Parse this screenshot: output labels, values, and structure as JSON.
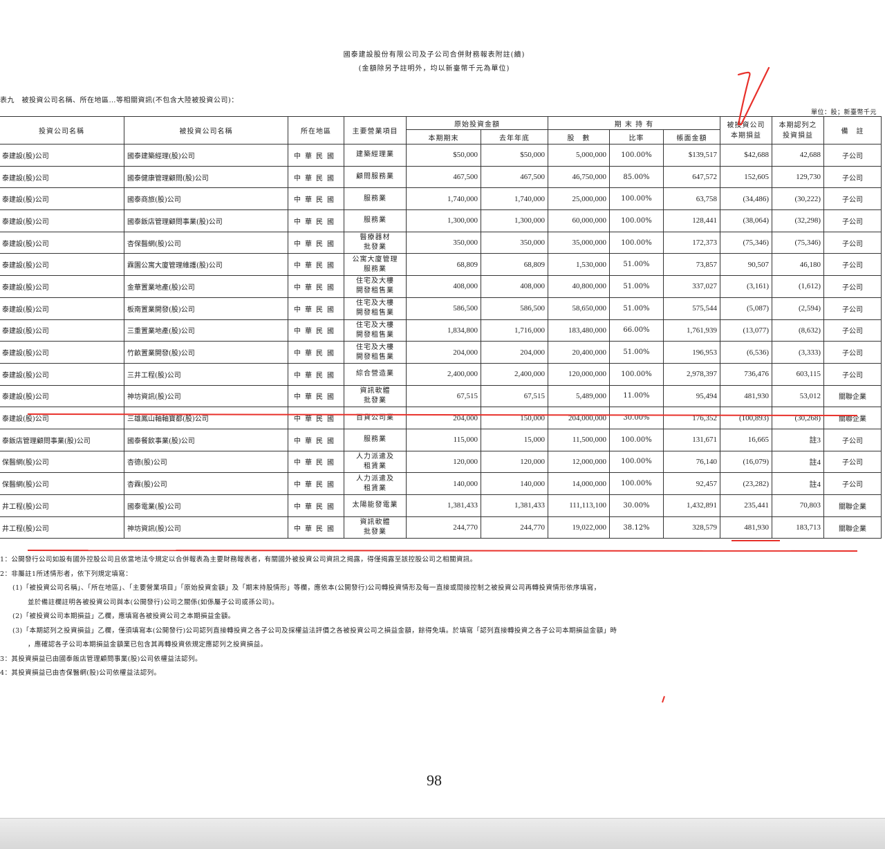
{
  "header": {
    "title": "國泰建設股份有限公司及子公司合併財務報表附註(續)",
    "subtitle": "(金額除另予註明外，均以新臺幣千元為單位)"
  },
  "caption": "表九　被投資公司名稱、所在地區…等相關資訊(不包含大陸被投資公司)：",
  "unit_note": "單位：股；新臺幣千元",
  "table": {
    "headers": {
      "investor": "投資公司名稱",
      "investee": "被投資公司名稱",
      "region": "所在地區",
      "business": "主要營業項目",
      "original": "原始投資金額",
      "orig_current": "本期期末",
      "orig_prior": "去年年底",
      "holding": "期 末 持 有",
      "shares": "股　數",
      "ratio": "比率",
      "book": "帳面金額",
      "pl_line1": "被投資公司",
      "pl_line2": "本期損益",
      "recog_line1": "本期認列之",
      "recog_line2": "投資損益",
      "remark": "備　註"
    },
    "rows": [
      {
        "investor": "泰建設(股)公司",
        "investee": "國泰建築經理(股)公司",
        "region": "中華民國",
        "business": "建築經理業",
        "orig_current": "$50,000",
        "orig_prior": "$50,000",
        "shares": "5,000,000",
        "ratio": "100.00%",
        "book": "$139,517",
        "pl": "$42,688",
        "recog": "42,688",
        "remark": "子公司"
      },
      {
        "investor": "泰建設(股)公司",
        "investee": "國泰健康管理顧問(股)公司",
        "region": "中華民國",
        "business": "顧問服務業",
        "orig_current": "467,500",
        "orig_prior": "467,500",
        "shares": "46,750,000",
        "ratio": "85.00%",
        "book": "647,572",
        "pl": "152,605",
        "recog": "129,730",
        "remark": "子公司"
      },
      {
        "investor": "泰建設(股)公司",
        "investee": "國泰商旅(股)公司",
        "region": "中華民國",
        "business": "服務業",
        "orig_current": "1,740,000",
        "orig_prior": "1,740,000",
        "shares": "25,000,000",
        "ratio": "100.00%",
        "book": "63,758",
        "pl": "(34,486)",
        "recog": "(30,222)",
        "remark": "子公司"
      },
      {
        "investor": "泰建設(股)公司",
        "investee": "國泰飯店管理顧問事業(股)公司",
        "region": "中華民國",
        "business": "服務業",
        "orig_current": "1,300,000",
        "orig_prior": "1,300,000",
        "shares": "60,000,000",
        "ratio": "100.00%",
        "book": "128,441",
        "pl": "(38,064)",
        "recog": "(32,298)",
        "remark": "子公司"
      },
      {
        "investor": "泰建設(股)公司",
        "investee": "杏保醫網(股)公司",
        "region": "中華民國",
        "business": "醫療器材 批發業",
        "orig_current": "350,000",
        "orig_prior": "350,000",
        "shares": "35,000,000",
        "ratio": "100.00%",
        "book": "172,373",
        "pl": "(75,346)",
        "recog": "(75,346)",
        "remark": "子公司"
      },
      {
        "investor": "泰建設(股)公司",
        "investee": "霖園公寓大廈管理維護(股)公司",
        "region": "中華民國",
        "business": "公寓大廈管理 服務業",
        "orig_current": "68,809",
        "orig_prior": "68,809",
        "shares": "1,530,000",
        "ratio": "51.00%",
        "book": "73,857",
        "pl": "90,507",
        "recog": "46,180",
        "remark": "子公司"
      },
      {
        "investor": "泰建設(股)公司",
        "investee": "金華置業地產(股)公司",
        "region": "中華民國",
        "business": "住宅及大樓 開發租售業",
        "orig_current": "408,000",
        "orig_prior": "408,000",
        "shares": "40,800,000",
        "ratio": "51.00%",
        "book": "337,027",
        "pl": "(3,161)",
        "recog": "(1,612)",
        "remark": "子公司"
      },
      {
        "investor": "泰建設(股)公司",
        "investee": "板南置業開發(股)公司",
        "region": "中華民國",
        "business": "住宅及大樓 開發租售業",
        "orig_current": "586,500",
        "orig_prior": "586,500",
        "shares": "58,650,000",
        "ratio": "51.00%",
        "book": "575,544",
        "pl": "(5,087)",
        "recog": "(2,594)",
        "remark": "子公司"
      },
      {
        "investor": "泰建設(股)公司",
        "investee": "三重置業地產(股)公司",
        "region": "中華民國",
        "business": "住宅及大樓 開發租售業",
        "orig_current": "1,834,800",
        "orig_prior": "1,716,000",
        "shares": "183,480,000",
        "ratio": "66.00%",
        "book": "1,761,939",
        "pl": "(13,077)",
        "recog": "(8,632)",
        "remark": "子公司"
      },
      {
        "investor": "泰建設(股)公司",
        "investee": "竹畝置業開發(股)公司",
        "region": "中華民國",
        "business": "住宅及大樓 開發租售業",
        "orig_current": "204,000",
        "orig_prior": "204,000",
        "shares": "20,400,000",
        "ratio": "51.00%",
        "book": "196,953",
        "pl": "(6,536)",
        "recog": "(3,333)",
        "remark": "子公司"
      },
      {
        "investor": "泰建設(股)公司",
        "investee": "三井工程(股)公司",
        "region": "中華民國",
        "business": "綜合營造業",
        "orig_current": "2,400,000",
        "orig_prior": "2,400,000",
        "shares": "120,000,000",
        "ratio": "100.00%",
        "book": "2,978,397",
        "pl": "736,476",
        "recog": "603,115",
        "remark": "子公司"
      },
      {
        "investor": "泰建設(股)公司",
        "investee": "神坊資訊(股)公司",
        "region": "中華民國",
        "business": "資訊軟體 批發業",
        "orig_current": "67,515",
        "orig_prior": "67,515",
        "shares": "5,489,000",
        "ratio": "11.00%",
        "book": "95,494",
        "pl": "481,930",
        "recog": "53,012",
        "remark": "關聯企業"
      },
      {
        "investor": "泰建設(股)公司",
        "investee": "三雄鳳山軸軸寶都(股)公司",
        "region": "中華民國",
        "business": "百貨公司業",
        "orig_current": "204,000",
        "orig_prior": "150,000",
        "shares": "204,000,000",
        "ratio": "30.00%",
        "book": "176,352",
        "pl": "(100,893)",
        "recog": "(30,268)",
        "remark": "關聯企業"
      },
      {
        "investor": "泰飯店管理顧問事業(股)公司",
        "investee": "國泰餐飲事業(股)公司",
        "region": "中華民國",
        "business": "服務業",
        "orig_current": "115,000",
        "orig_prior": "15,000",
        "shares": "11,500,000",
        "ratio": "100.00%",
        "book": "131,671",
        "pl": "16,665",
        "recog": "註3",
        "remark": "子公司"
      },
      {
        "investor": "保醫網(股)公司",
        "investee": "杏德(股)公司",
        "region": "中華民國",
        "business": "人力派遣及 租賃業",
        "orig_current": "120,000",
        "orig_prior": "120,000",
        "shares": "12,000,000",
        "ratio": "100.00%",
        "book": "76,140",
        "pl": "(16,079)",
        "recog": "註4",
        "remark": "子公司"
      },
      {
        "investor": "保醫網(股)公司",
        "investee": "杏霖(股)公司",
        "region": "中華民國",
        "business": "人力派遣及 租賃業",
        "orig_current": "140,000",
        "orig_prior": "140,000",
        "shares": "14,000,000",
        "ratio": "100.00%",
        "book": "92,457",
        "pl": "(23,282)",
        "recog": "註4",
        "remark": "子公司"
      },
      {
        "investor": "井工程(股)公司",
        "investee": "國泰電業(股)公司",
        "region": "中華民國",
        "business": "太陽能發電業",
        "orig_current": "1,381,433",
        "orig_prior": "1,381,433",
        "shares": "111,113,100",
        "ratio": "30.00%",
        "book": "1,432,891",
        "pl": "235,441",
        "recog": "70,803",
        "remark": "關聯企業"
      },
      {
        "investor": "井工程(股)公司",
        "investee": "神坊資訊(股)公司",
        "region": "中華民國",
        "business": "資訊軟體 批發業",
        "orig_current": "244,770",
        "orig_prior": "244,770",
        "shares": "19,022,000",
        "ratio": "38.12%",
        "book": "328,579",
        "pl": "481,930",
        "recog": "183,713",
        "remark": "關聯企業"
      }
    ]
  },
  "notes": [
    "1：公開發行公司如設有國外控股公司且依當地法令規定以合併報表為主要財務報表者，有關國外被投資公司資訊之揭露，得僅揭露至該控股公司之相關資訊。",
    "2：非屬註1所述情形者，依下列規定填寫：",
    "(1)「被投資公司名稱」、「所在地區」、「主要營業項目」「原始投資金額」及「期末持股情形」等欄，應依本(公開發行)公司轉投資情形及每一直接或間接控制之被投資公司再轉投資情形依序填寫，",
    "並於備註欄註明各被投資公司與本(公開發行)公司之關係(如係屬子公司或孫公司)。",
    "(2)「被投資公司本期損益」乙欄，應填寫各被投資公司之本期損益金額。",
    "(3)「本期認列之投資損益」乙欄，僅須填寫本(公開發行)公司認列直接轉投資之各子公司及採權益法評價之各被投資公司之損益金額，餘得免填。於填寫「認列直接轉投資之各子公司本期損益金額」時",
    "，應確認各子公司本期損益金額業已包含其再轉投資依規定應認列之投資損益。",
    "3：其投資損益已由國泰飯店管理顧問事業(股)公司依權益法認列。",
    "4：其投資損益已由杏保醫網(股)公司依權益法認列。"
  ],
  "page_number": "98",
  "colors": {
    "annotation": "#e8302a",
    "border": "#333333",
    "text": "#222222"
  }
}
